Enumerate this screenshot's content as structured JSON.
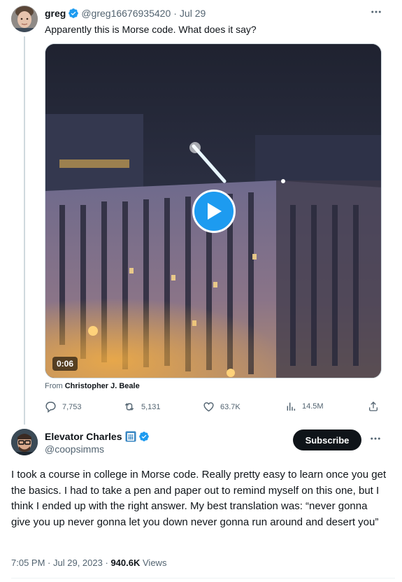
{
  "colors": {
    "accent": "#1d9bf0",
    "text": "#0f1419",
    "muted": "#536471",
    "divider": "#cfd9de"
  },
  "first_tweet": {
    "author_name": "greg",
    "handle": "@greg16676935420",
    "separator": "·",
    "date": "Jul 29",
    "text": "Apparently this is Morse code. What does it say?",
    "media": {
      "duration": "0:06",
      "type": "video"
    },
    "from_label": "From",
    "from_name": "Christopher J. Beale",
    "actions": {
      "replies": "7,753",
      "reposts": "5,131",
      "likes": "63.7K",
      "views": "14.5M"
    },
    "icons": [
      "reply-icon",
      "repost-icon",
      "like-icon",
      "views-icon",
      "share-icon",
      "play-icon",
      "verified-icon",
      "more-icon"
    ]
  },
  "main_tweet": {
    "author_name": "Elevator Charles",
    "handle": "@coopsimms",
    "subscribe_label": "Subscribe",
    "text": "I took a course in college in Morse code. Really pretty easy to learn once you get the basics. I had to take a pen and paper out to remind myself on this one, but I think I ended up with the right answer. My best translation was: “never gonna give you up never gonna let you down never gonna run around and desert you”",
    "time": "7:05 PM",
    "separator": "·",
    "date": "Jul 29, 2023",
    "separator2": "·",
    "views_count": "940.6K",
    "views_label": "Views"
  }
}
